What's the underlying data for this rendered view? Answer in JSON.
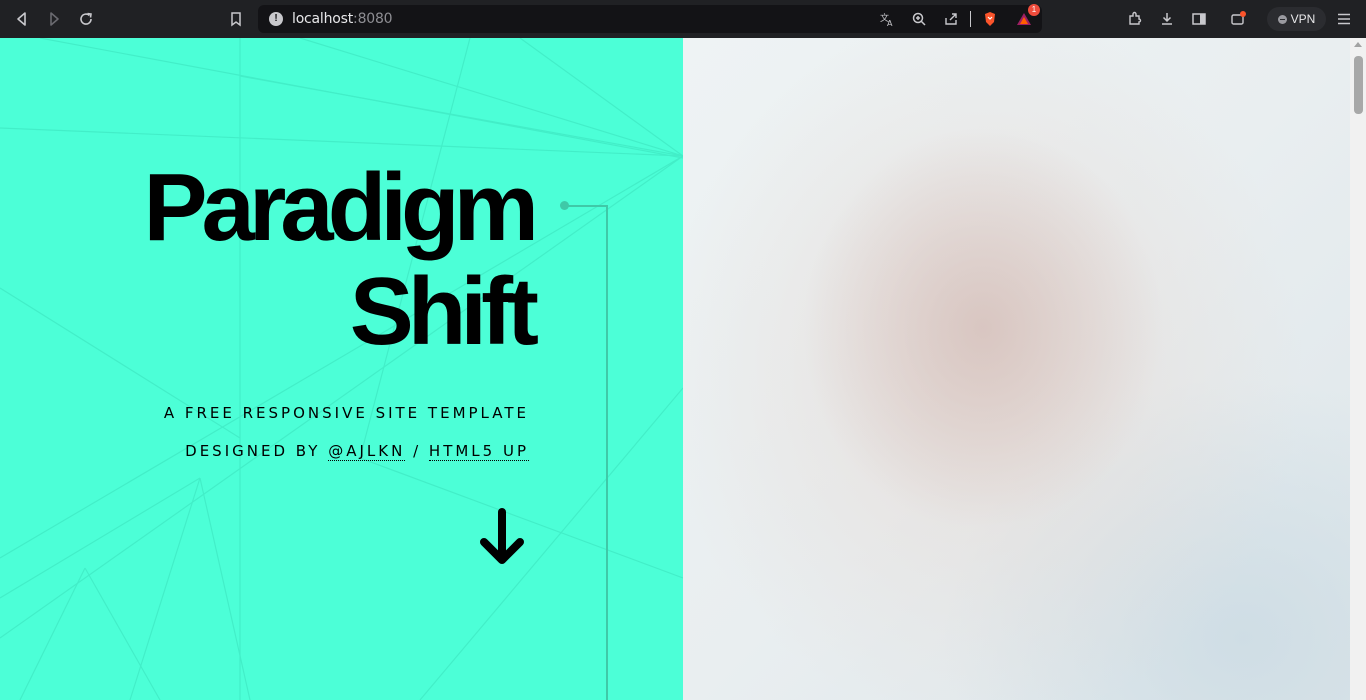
{
  "browser": {
    "url_host": "localhost",
    "url_port": ":8080",
    "notification_count": "1",
    "vpn_label": "VPN"
  },
  "icons": [
    "back-icon",
    "forward-icon",
    "reload-icon",
    "bookmark-icon",
    "site-info-icon",
    "translate-icon",
    "zoom-icon",
    "share-icon",
    "brave-shields-icon",
    "brave-rewards-icon",
    "extensions-icon",
    "downloads-icon",
    "sidebar-icon",
    "wallet-icon",
    "menu-icon",
    "arrow-down-icon"
  ],
  "page": {
    "title_line1": "Paradigm",
    "title_line2": "Shift",
    "tagline": "A FREE RESPONSIVE SITE TEMPLATE",
    "credit_prefix": "DESIGNED BY",
    "credit_author": "@AJLKN",
    "credit_separator": "/",
    "credit_site": "HTML5 UP"
  },
  "colors": {
    "accent": "#4cffd7",
    "connector": "#3fc9a8",
    "text": "#000000"
  }
}
